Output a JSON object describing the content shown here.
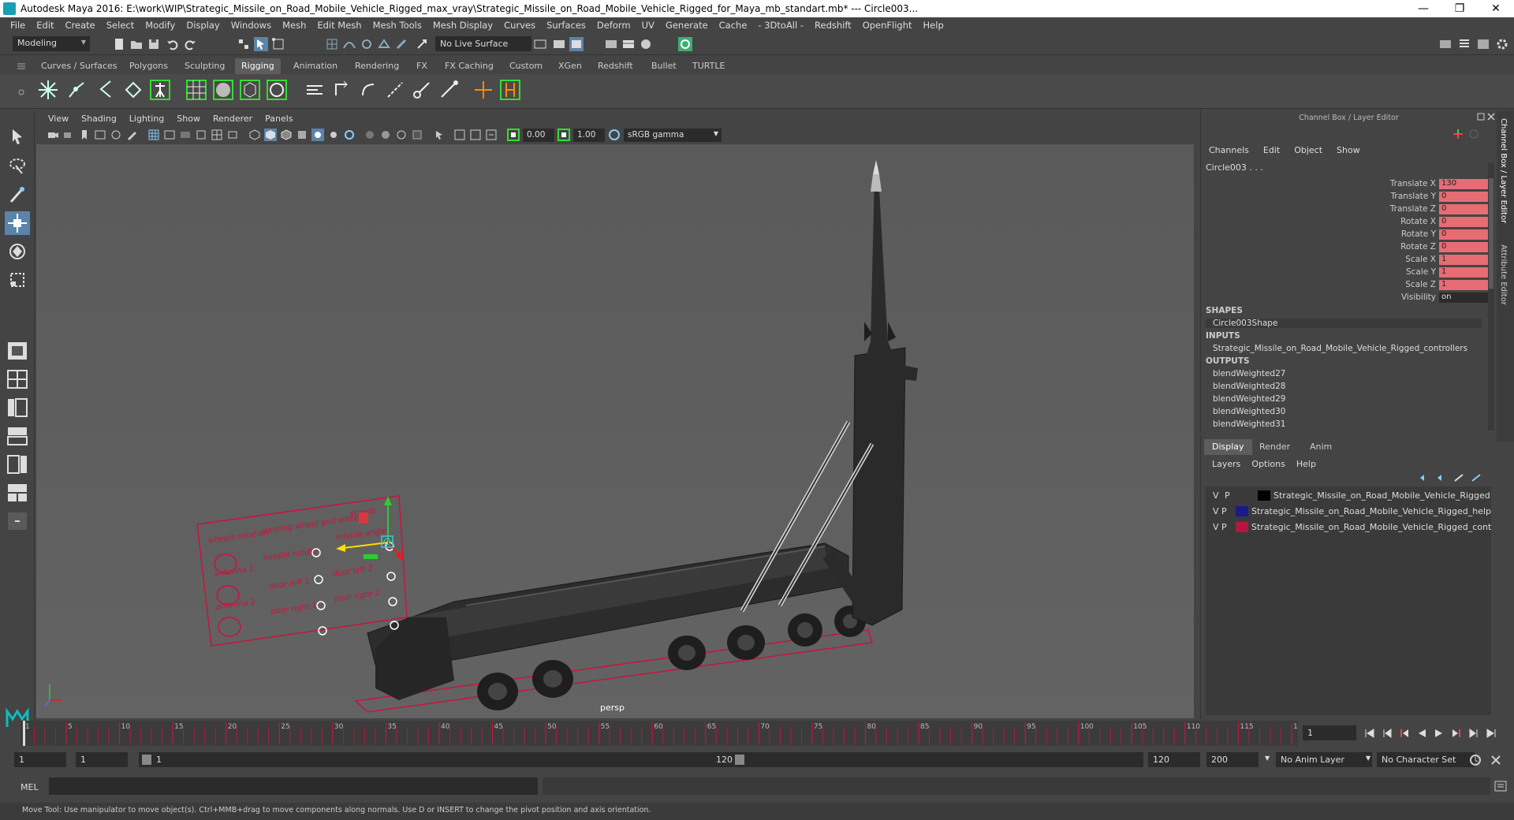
{
  "titlebar": {
    "title": "Autodesk Maya 2016: E:\\work\\WIP\\Strategic_Missile_on_Road_Mobile_Vehicle_Rigged_max_vray\\Strategic_Missile_on_Road_Mobile_Vehicle_Rigged_for_Maya_mb_standart.mb*   ---   Circle003...",
    "minimize": "—",
    "maximize": "❐",
    "close": "✕"
  },
  "menubar": [
    "File",
    "Edit",
    "Create",
    "Select",
    "Modify",
    "Display",
    "Windows",
    "Mesh",
    "Edit Mesh",
    "Mesh Tools",
    "Mesh Display",
    "Curves",
    "Surfaces",
    "Deform",
    "UV",
    "Generate",
    "Cache",
    "- 3DtoAll -",
    "Redshift",
    "OpenFlight",
    "Help"
  ],
  "statusline": {
    "mode": "Modeling",
    "live_surface": "No Live Surface"
  },
  "shelf_tabs": [
    "Curves / Surfaces",
    "Polygons",
    "Sculpting",
    "Rigging",
    "Animation",
    "Rendering",
    "FX",
    "FX Caching",
    "Custom",
    "XGen",
    "Redshift",
    "Bullet",
    "TURTLE"
  ],
  "shelf_active_tab": "Rigging",
  "viewport": {
    "menu": [
      "View",
      "Shading",
      "Lighting",
      "Show",
      "Renderer",
      "Panels"
    ],
    "exposure": "0.00",
    "gamma": "1.00",
    "color_space": "sRGB gamma",
    "camera_label": "persp",
    "control_board_labels": [
      "wheels rotation",
      "steering wheel and wheels",
      "missile holder",
      "stands",
      "missile angle",
      "antenna 1",
      "antenna 2",
      "door left 1",
      "door left 2",
      "door right 1",
      "door right 2"
    ]
  },
  "channel_box": {
    "title": "Channel Box / Layer Editor",
    "menu": [
      "Channels",
      "Edit",
      "Object",
      "Show"
    ],
    "object": "Circle003 . . .",
    "attributes": [
      {
        "label": "Translate X",
        "value": "130"
      },
      {
        "label": "Translate Y",
        "value": "0"
      },
      {
        "label": "Translate Z",
        "value": "0"
      },
      {
        "label": "Rotate X",
        "value": "0"
      },
      {
        "label": "Rotate Y",
        "value": "0"
      },
      {
        "label": "Rotate Z",
        "value": "0"
      },
      {
        "label": "Scale X",
        "value": "1"
      },
      {
        "label": "Scale Y",
        "value": "1"
      },
      {
        "label": "Scale Z",
        "value": "1"
      },
      {
        "label": "Visibility",
        "value": "on"
      }
    ],
    "shapes_header": "SHAPES",
    "shape": "Circle003Shape",
    "inputs_header": "INPUTS",
    "input": "Strategic_Missile_on_Road_Mobile_Vehicle_Rigged_controllers",
    "outputs_header": "OUTPUTS",
    "outputs": [
      "blendWeighted27",
      "blendWeighted28",
      "blendWeighted29",
      "blendWeighted30",
      "blendWeighted31"
    ]
  },
  "layer_editor": {
    "tabs": [
      "Display",
      "Render",
      "Anim"
    ],
    "active_tab": "Display",
    "menu": [
      "Layers",
      "Options",
      "Help"
    ],
    "layers": [
      {
        "v": "V",
        "p": "P",
        "color": "#000000",
        "name": "Strategic_Missile_on_Road_Mobile_Vehicle_Rigged"
      },
      {
        "v": "V",
        "p": "P",
        "color": "#1a1a8c",
        "name": "Strategic_Missile_on_Road_Mobile_Vehicle_Rigged_help"
      },
      {
        "v": "V",
        "p": "P",
        "color": "#b3173f",
        "name": "Strategic_Missile_on_Road_Mobile_Vehicle_Rigged_cont"
      }
    ]
  },
  "side_tabs": [
    "Channel Box / Layer Editor",
    "Attribute Editor"
  ],
  "timeline": {
    "ticks": [
      "1",
      "5",
      "10",
      "15",
      "20",
      "25",
      "30",
      "35",
      "40",
      "45",
      "50",
      "55",
      "60",
      "65",
      "70",
      "75",
      "80",
      "85",
      "90",
      "95",
      "100",
      "105",
      "110",
      "115",
      "120"
    ],
    "current_frame": "1"
  },
  "range": {
    "start": "1",
    "playback_start": "1",
    "slider_start": "1",
    "slider_end": "120",
    "playback_end": "120",
    "end": "200",
    "anim_layer": "No Anim Layer",
    "character_set": "No Character Set"
  },
  "command": {
    "label": "MEL"
  },
  "help_line": "Move Tool: Use manipulator to move object(s). Ctrl+MMB+drag to move components along normals. Use D or INSERT to change the pivot position and axis orientation.",
  "colors": {
    "accent": "#5d5d5d",
    "rig_red": "#c8143c",
    "attr_highlight": "#e86c74"
  }
}
